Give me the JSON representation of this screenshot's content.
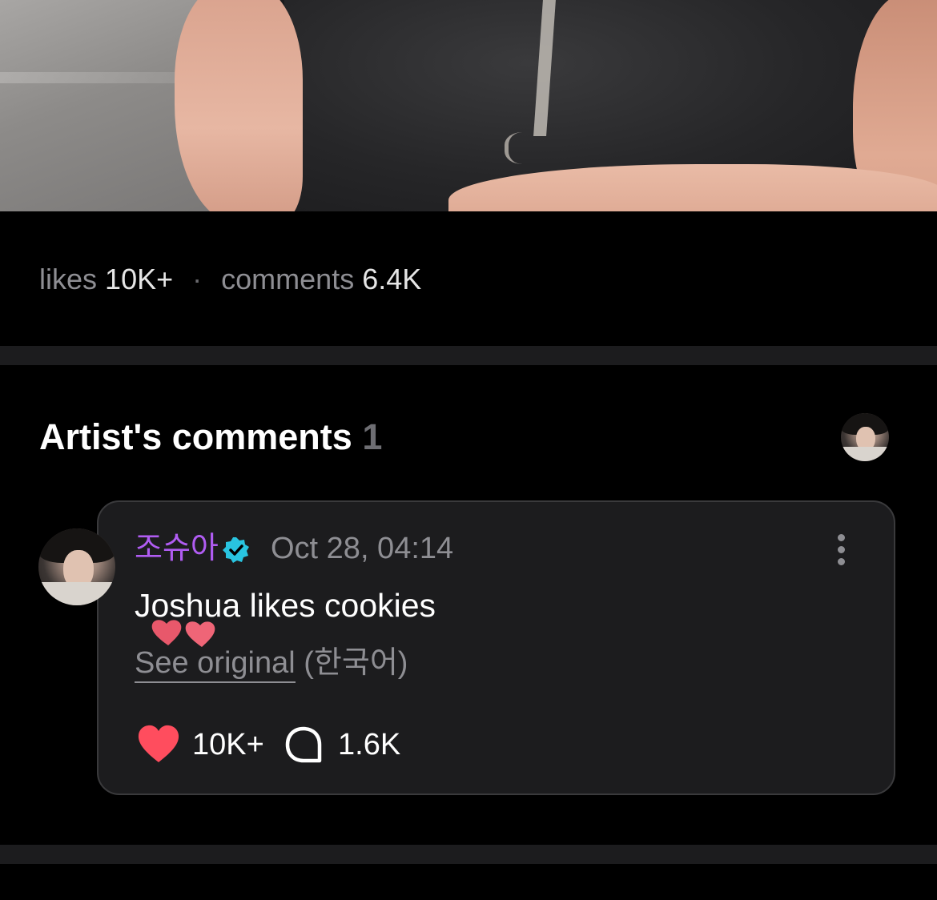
{
  "post": {
    "likes_label": "likes",
    "likes_value": "10K+",
    "separator": "·",
    "comments_label": "comments",
    "comments_value": "6.4K"
  },
  "artist_comments": {
    "title": "Artist's comments",
    "count": "1"
  },
  "comment": {
    "author": "조슈아",
    "verified_icon": "verified-badge-icon",
    "timestamp": "Oct 28, 04:14",
    "text": "Joshua likes cookies",
    "decoration_icon": "two-hearts-icon",
    "see_original": "See original",
    "original_language": "(한국어)",
    "likes": "10K+",
    "replies": "1.6K"
  },
  "colors": {
    "background": "#000000",
    "card": "#1c1c1e",
    "username": "#b05cf2",
    "verified": "#29c4e0",
    "heart": "#ff4d5e",
    "muted": "#8e8e93"
  }
}
